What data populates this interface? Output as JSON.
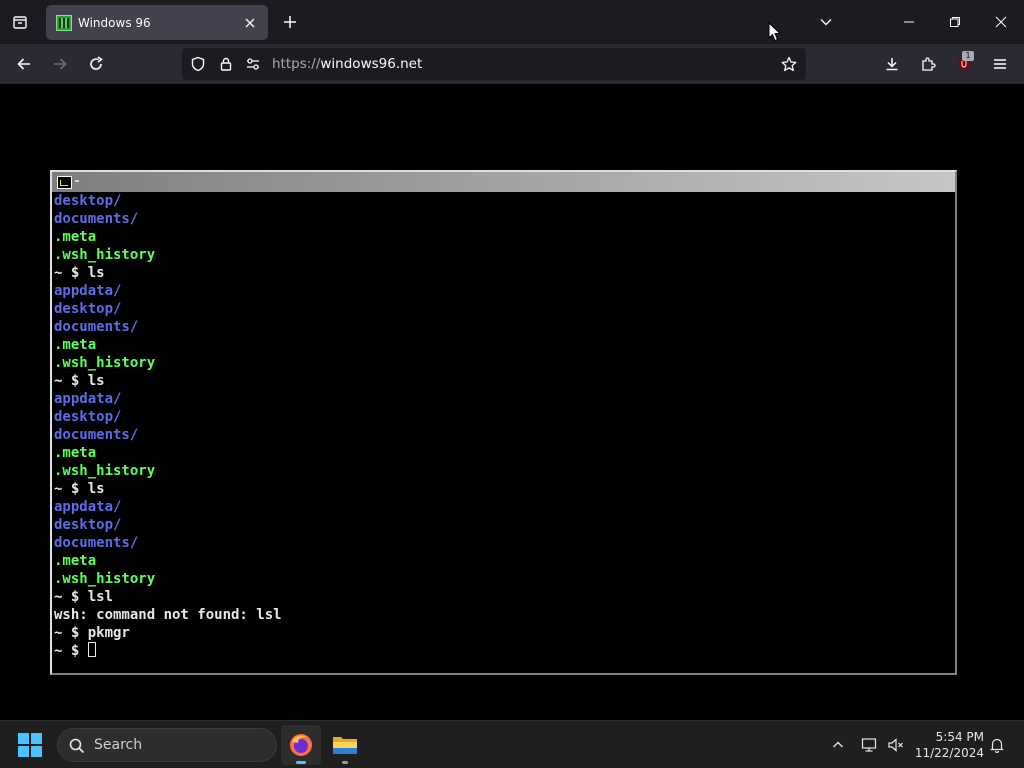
{
  "browser": {
    "tab_title": "Windows 96",
    "url_scheme": "https://",
    "url_host": "windows96.net",
    "extension_badge": "1"
  },
  "terminal": {
    "lines": [
      {
        "text": "desktop/",
        "kind": "dir"
      },
      {
        "text": "documents/",
        "kind": "dir"
      },
      {
        "text": ".meta",
        "kind": "file"
      },
      {
        "text": ".wsh_history",
        "kind": "file"
      },
      {
        "text": "~ $ ls",
        "kind": "cmd"
      },
      {
        "text": "appdata/",
        "kind": "dir"
      },
      {
        "text": "desktop/",
        "kind": "dir"
      },
      {
        "text": "documents/",
        "kind": "dir"
      },
      {
        "text": ".meta",
        "kind": "file"
      },
      {
        "text": ".wsh_history",
        "kind": "file"
      },
      {
        "text": "~ $ ls",
        "kind": "cmd"
      },
      {
        "text": "appdata/",
        "kind": "dir"
      },
      {
        "text": "desktop/",
        "kind": "dir"
      },
      {
        "text": "documents/",
        "kind": "dir"
      },
      {
        "text": ".meta",
        "kind": "file"
      },
      {
        "text": ".wsh_history",
        "kind": "file"
      },
      {
        "text": "~ $ ls",
        "kind": "cmd"
      },
      {
        "text": "appdata/",
        "kind": "dir"
      },
      {
        "text": "desktop/",
        "kind": "dir"
      },
      {
        "text": "documents/",
        "kind": "dir"
      },
      {
        "text": ".meta",
        "kind": "file"
      },
      {
        "text": ".wsh_history",
        "kind": "file"
      },
      {
        "text": "~ $ lsl",
        "kind": "cmd"
      },
      {
        "text": "wsh: command not found: lsl",
        "kind": "err"
      },
      {
        "text": "~ $ pkmgr",
        "kind": "cmd"
      }
    ],
    "prompt": "~ $ "
  },
  "taskbar": {
    "search_placeholder": "Search",
    "time": "5:54 PM",
    "date": "11/22/2024"
  },
  "colors": {
    "dir": "#5c6ce8",
    "file": "#5fff5f",
    "cmd": "#e8e8e8",
    "accent": "#4cc2ff"
  }
}
